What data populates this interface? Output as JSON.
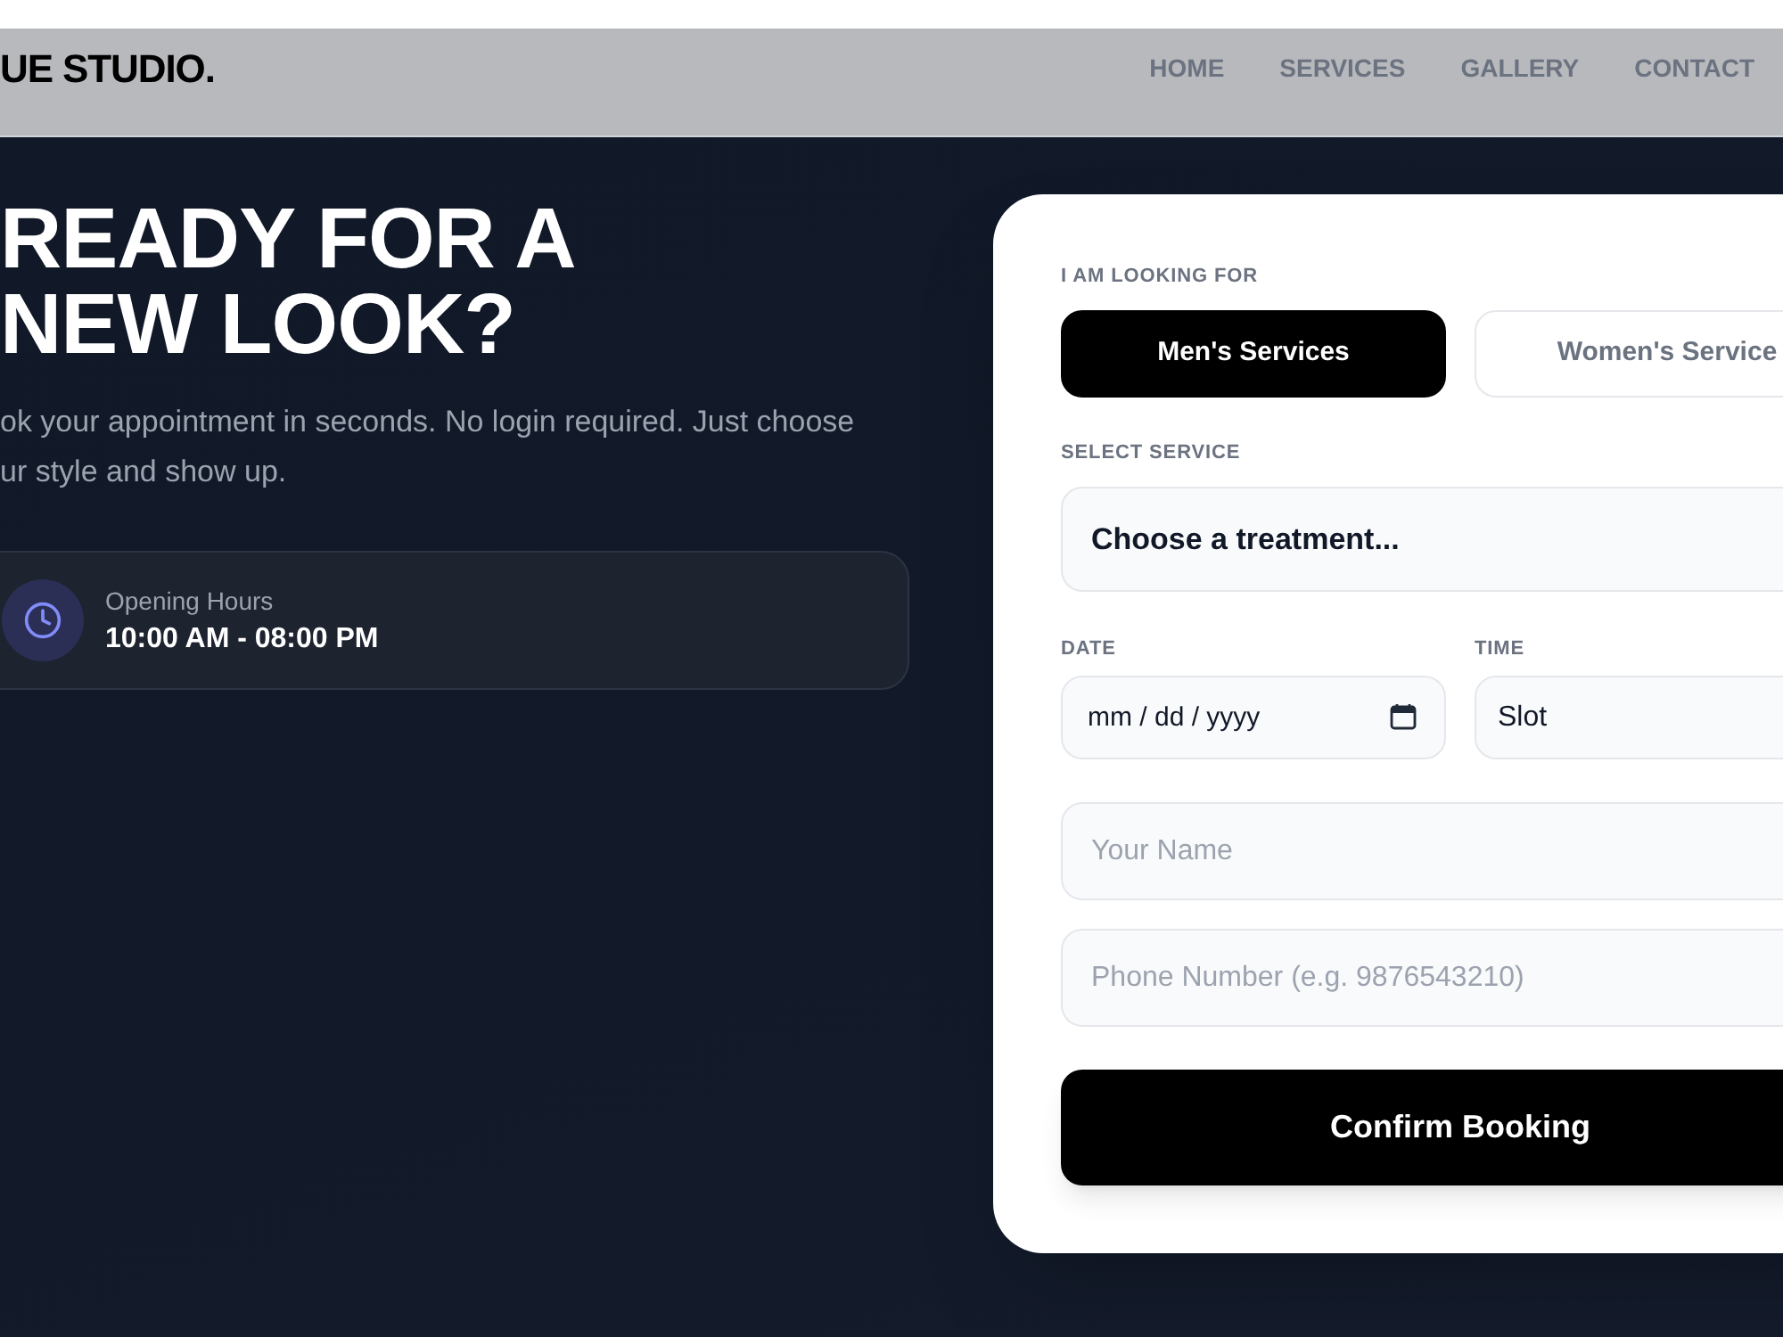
{
  "header": {
    "logo": "UE STUDIO.",
    "nav": [
      "HOME",
      "SERVICES",
      "GALLERY",
      "CONTACT"
    ]
  },
  "hero": {
    "title": "READY FOR A NEW LOOK?",
    "description": "ok your appointment in seconds. No login required. Just choose\nur style and show up.",
    "hours": {
      "label": "Opening Hours",
      "value": "10:00 AM - 08:00 PM"
    }
  },
  "booking_form": {
    "category_label": "I AM LOOKING FOR",
    "categories": [
      {
        "label": "Men's Services",
        "selected": true
      },
      {
        "label": "Women's Service",
        "selected": false
      }
    ],
    "service": {
      "label": "SELECT SERVICE",
      "value": "Choose a treatment..."
    },
    "date": {
      "label": "DATE",
      "placeholder": "mm / dd / yyyy"
    },
    "time": {
      "label": "TIME",
      "value": "Slot"
    },
    "name": {
      "placeholder": "Your Name"
    },
    "phone": {
      "placeholder": "Phone Number (e.g. 9876543210)"
    },
    "submit": "Confirm Booking"
  }
}
